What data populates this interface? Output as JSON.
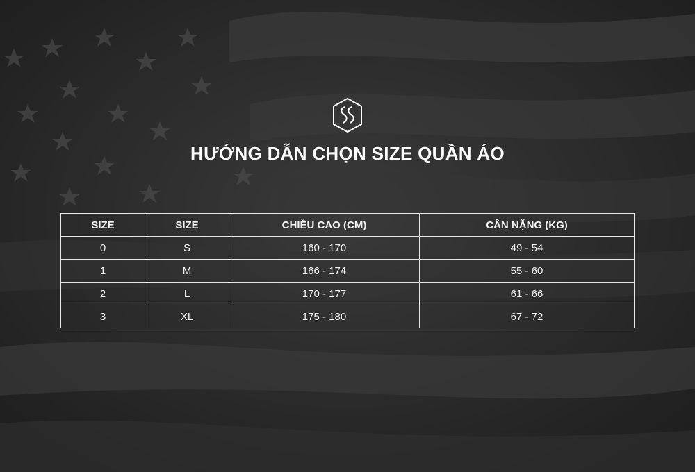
{
  "title": "HƯỚNG DẪN CHỌN SIZE QUẦN ÁO",
  "logo": {
    "icon": "ss-shield-logo"
  },
  "table": {
    "headers": [
      "SIZE",
      "SIZE",
      "CHIỀU CAO (CM)",
      "CÂN NẶNG (KG)"
    ],
    "rows": [
      [
        "0",
        "S",
        "160 - 170",
        "49 - 54"
      ],
      [
        "1",
        "M",
        "166 - 174",
        "55 - 60"
      ],
      [
        "2",
        "L",
        "170 - 177",
        "61 - 66"
      ],
      [
        "3",
        "XL",
        "175 - 180",
        "67 - 72"
      ]
    ]
  },
  "colors": {
    "background": "#2a2a2a",
    "text": "#ffffff",
    "border": "#e6e6e6"
  }
}
